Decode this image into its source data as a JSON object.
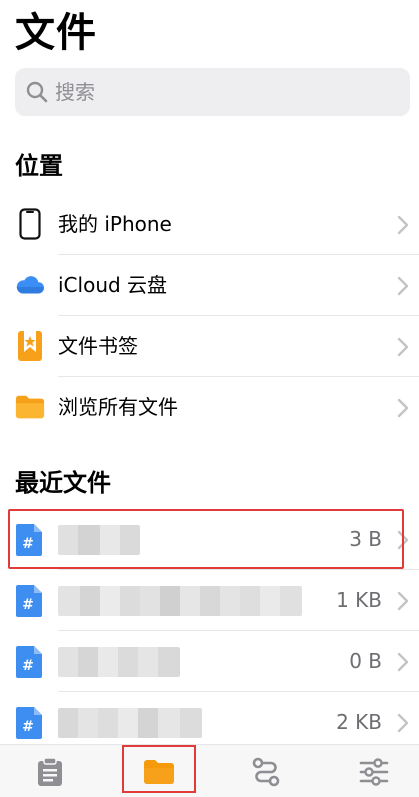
{
  "header": {
    "title": "文件"
  },
  "search": {
    "placeholder": "搜索"
  },
  "locations": {
    "title": "位置",
    "items": [
      {
        "label": "我的 iPhone",
        "icon": "iphone-icon"
      },
      {
        "label": "iCloud 云盘",
        "icon": "icloud-icon"
      },
      {
        "label": "文件书签",
        "icon": "bookmark-icon"
      },
      {
        "label": "浏览所有文件",
        "icon": "folder-icon"
      }
    ]
  },
  "recent": {
    "title": "最近文件",
    "items": [
      {
        "size": "3 B",
        "icon": "hash-file-icon"
      },
      {
        "size": "1 KB",
        "icon": "hash-file-icon"
      },
      {
        "size": "0 B",
        "icon": "hash-file-icon"
      },
      {
        "size": "2 KB",
        "icon": "hash-file-icon"
      }
    ]
  },
  "tabbar": {
    "tabs": [
      {
        "icon": "clipboard-icon"
      },
      {
        "icon": "folder-icon",
        "active": true
      },
      {
        "icon": "route-icon"
      },
      {
        "icon": "sliders-icon"
      }
    ]
  },
  "colors": {
    "accent": "#f7a11a",
    "icloud": "#3a8ef6",
    "file": "#3d8ef0",
    "highlight": "#e13a3a"
  }
}
